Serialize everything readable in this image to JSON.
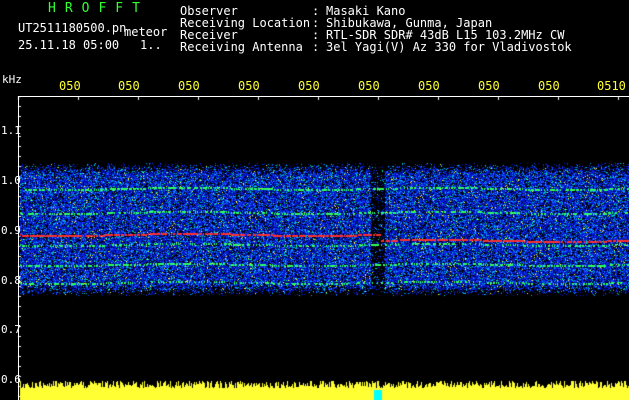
{
  "header": {
    "app_title": "HROFFT",
    "file_name": "UT2511180500.pn",
    "file_tag": "meteor",
    "date_time": "25.11.18 05:00",
    "small_flag": "1..",
    "info": [
      {
        "label": "Observer",
        "value": "Masaki Kano"
      },
      {
        "label": "Receiving Location",
        "value": "Shibukawa, Gunma, Japan"
      },
      {
        "label": "Receiver",
        "value": "RTL-SDR SDR# 43dB L15 103.2MHz CW"
      },
      {
        "label": "Receiving Antenna",
        "value": "3el Yagi(V) Az 330 for Vladivostok"
      }
    ]
  },
  "axes": {
    "unit": "kHz",
    "time_ticks": [
      "050",
      "050",
      "050",
      "050",
      "050",
      "050",
      "050",
      "050",
      "050",
      "0510"
    ],
    "freq_labels": [
      "1.1",
      "1.0",
      "0.9",
      "0.8",
      "0.7",
      "0.6"
    ]
  },
  "colors": {
    "header_green": "#33ff33",
    "axis_yellow": "#ffff33",
    "text_white": "#ffffff",
    "background": "#000000",
    "noise_blue": "#1e3cff",
    "signal_red": "#ff3030",
    "marker_cyan": "#00ffff"
  }
}
